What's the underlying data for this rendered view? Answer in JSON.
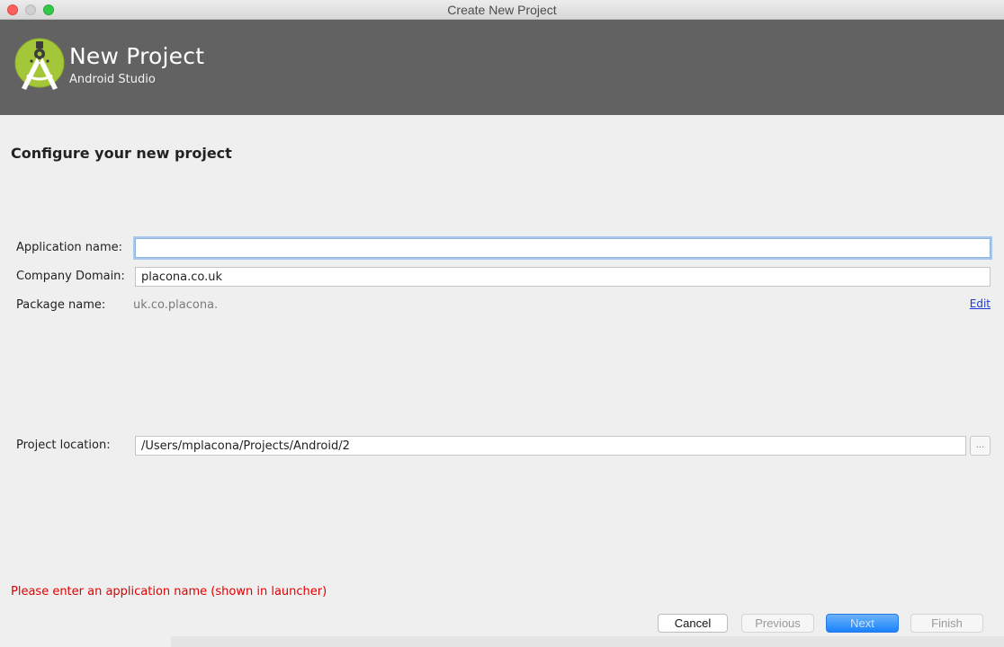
{
  "window": {
    "title": "Create New Project"
  },
  "header": {
    "title": "New Project",
    "subtitle": "Android Studio"
  },
  "form": {
    "section_title": "Configure your new project",
    "application_name": {
      "label": "Application name:",
      "value": ""
    },
    "company_domain": {
      "label": "Company Domain:",
      "value": "placona.co.uk"
    },
    "package_name": {
      "label": "Package name:",
      "value": "uk.co.placona.",
      "edit_label": "Edit"
    },
    "project_location": {
      "label": "Project location:",
      "value": "/Users/mplacona/Projects/Android/2",
      "browse_label": "..."
    }
  },
  "error": {
    "message": "Please enter an application name (shown in launcher)",
    "color": "#e00000"
  },
  "buttons": {
    "cancel": "Cancel",
    "previous": "Previous",
    "next": "Next",
    "finish": "Finish"
  },
  "colors": {
    "header_bg": "#626262",
    "android_green": "#a4c639",
    "next_blue": "#1a82fb"
  },
  "icons": {
    "logo": "android-studio-logo-icon"
  }
}
